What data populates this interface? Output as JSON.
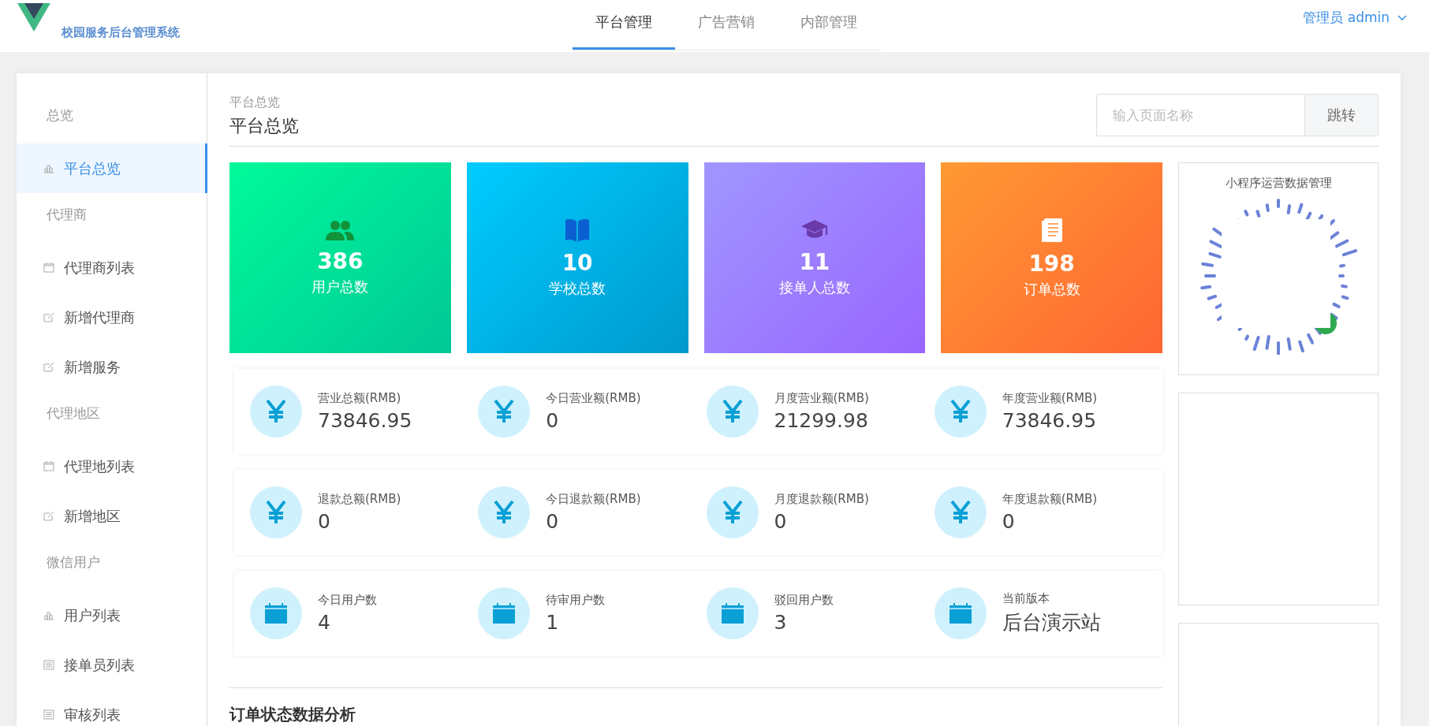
{
  "header": {
    "title": "校园服务后台管理系统",
    "tabs": [
      {
        "label": "平台管理",
        "selected": true
      },
      {
        "label": "广告营销",
        "selected": false
      },
      {
        "label": "内部管理",
        "selected": false
      }
    ],
    "user": "管理员 admin"
  },
  "sidebar": {
    "groups": [
      {
        "title": "总览",
        "items": [
          {
            "label": "平台总览",
            "kind": "chart",
            "selected": true
          }
        ]
      },
      {
        "title": "代理商",
        "items": [
          {
            "label": "代理商列表",
            "kind": "calendar",
            "selected": false
          },
          {
            "label": "新增代理商",
            "kind": "edit",
            "selected": false
          },
          {
            "label": "新增服务",
            "kind": "edit",
            "selected": false
          }
        ]
      },
      {
        "title": "代理地区",
        "items": [
          {
            "label": "代理地列表",
            "kind": "calendar",
            "selected": false
          },
          {
            "label": "新增地区",
            "kind": "edit",
            "selected": false
          }
        ]
      },
      {
        "title": "微信用户",
        "items": [
          {
            "label": "用户列表",
            "kind": "chart",
            "selected": false
          },
          {
            "label": "接单员列表",
            "kind": "list",
            "selected": false
          },
          {
            "label": "审核列表",
            "kind": "list",
            "selected": false
          }
        ]
      }
    ]
  },
  "page": {
    "breadcrumb": "平台总览",
    "title": "平台总览",
    "search": {
      "placeholder": "输入页面名称",
      "button": "跳转"
    }
  },
  "stats": [
    {
      "kind": "users",
      "value": "386",
      "label": "用户总数"
    },
    {
      "kind": "book",
      "value": "10",
      "label": "学校总数"
    },
    {
      "kind": "cap",
      "value": "11",
      "label": "接单人总数"
    },
    {
      "kind": "doc",
      "value": "198",
      "label": "订单总数"
    }
  ],
  "info_rows": [
    [
      {
        "kind": "yen",
        "label": "营业总额(RMB)",
        "value": "73846.95"
      },
      {
        "kind": "yen",
        "label": "今日营业额(RMB)",
        "value": "0"
      },
      {
        "kind": "yen",
        "label": "月度营业额(RMB)",
        "value": "21299.98"
      },
      {
        "kind": "yen",
        "label": "年度营业额(RMB)",
        "value": "73846.95"
      }
    ],
    [
      {
        "kind": "yen",
        "label": "退款总额(RMB)",
        "value": "0"
      },
      {
        "kind": "yen",
        "label": "今日退款额(RMB)",
        "value": "0"
      },
      {
        "kind": "yen",
        "label": "月度退款额(RMB)",
        "value": "0"
      },
      {
        "kind": "yen",
        "label": "年度退款额(RMB)",
        "value": "0"
      }
    ],
    [
      {
        "kind": "calendar",
        "label": "今日用户数",
        "value": "4"
      },
      {
        "kind": "calendar",
        "label": "待审用户数",
        "value": "1"
      },
      {
        "kind": "calendar",
        "label": "驳回用户数",
        "value": "3"
      },
      {
        "kind": "calendar",
        "label": "当前版本",
        "value": "后台演示站"
      }
    ]
  ],
  "section_title": "订单状态数据分析",
  "side_panels": [
    {
      "title": "小程序运营数据管理",
      "kind": "code"
    },
    {
      "kind": "blank"
    },
    {
      "kind": "blank"
    }
  ]
}
